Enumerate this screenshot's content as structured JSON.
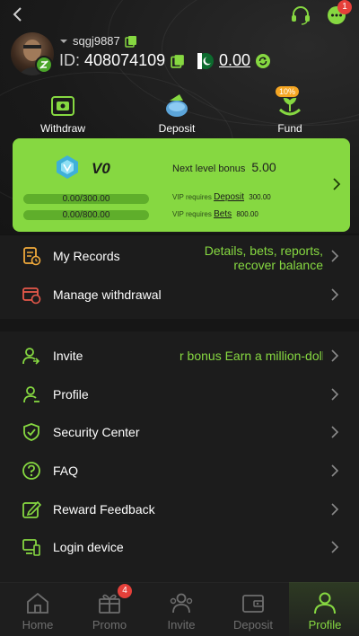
{
  "topbar": {
    "support_icon": "headset-icon",
    "chat_icon": "chat-icon",
    "chat_badge": "1"
  },
  "profile": {
    "username": "sqgj9887",
    "id_label": "ID:",
    "id_value": "408074109",
    "balance": "0.00",
    "flag_icon": "pakistan-flag-icon"
  },
  "actions": [
    {
      "label": "Withdraw",
      "icon": "withdraw-icon"
    },
    {
      "label": "Deposit",
      "icon": "wallet-icon"
    },
    {
      "label": "Fund",
      "icon": "fund-icon",
      "badge": "10%"
    }
  ],
  "vip": {
    "level": "V0",
    "next_label": "Next level bonus",
    "next_value": "5.00",
    "deposit_progress": "0.00/300.00",
    "bets_progress": "0.00/800.00",
    "req_prefix": "VIP requires",
    "deposit_label": "Deposit",
    "deposit_req": "300.00",
    "bets_label": "Bets",
    "bets_req": "800.00"
  },
  "menu_top": [
    {
      "label": "My Records",
      "extra": "Details, bets, reports, recover balance",
      "icon": "records-icon"
    },
    {
      "label": "Manage withdrawal",
      "icon": "manage-withdrawal-icon"
    }
  ],
  "menu": [
    {
      "label": "Invite",
      "extra": "r bonus  Earn a million-dolla",
      "icon": "invite-icon"
    },
    {
      "label": "Profile",
      "icon": "profile-icon"
    },
    {
      "label": "Security Center",
      "icon": "shield-icon"
    },
    {
      "label": "FAQ",
      "icon": "question-icon"
    },
    {
      "label": "Reward Feedback",
      "icon": "feedback-icon"
    },
    {
      "label": "Login device",
      "icon": "devices-icon"
    }
  ],
  "tabs": [
    {
      "label": "Home",
      "icon": "home-icon"
    },
    {
      "label": "Promo",
      "icon": "gift-icon",
      "badge": "4"
    },
    {
      "label": "Invite",
      "icon": "invite-people-icon"
    },
    {
      "label": "Deposit",
      "icon": "deposit-wallet-icon"
    },
    {
      "label": "Profile",
      "icon": "profile-person-icon",
      "active": true
    }
  ],
  "colors": {
    "accent": "#86d841",
    "badge": "#e5403a",
    "background": "#141414"
  }
}
